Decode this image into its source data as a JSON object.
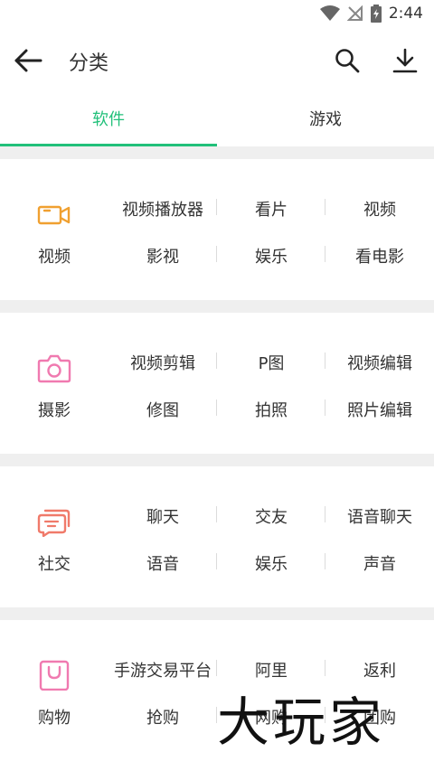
{
  "status": {
    "time": "2:44"
  },
  "appbar": {
    "title": "分类"
  },
  "tabs": [
    {
      "label": "软件"
    },
    {
      "label": "游戏"
    }
  ],
  "accent": "#22c07a",
  "categories": [
    {
      "name": "视频",
      "icon": "video-camera-icon",
      "color": "#f0a030",
      "tags": [
        "视频播放器",
        "看片",
        "视频",
        "影视",
        "娱乐",
        "看电影"
      ]
    },
    {
      "name": "摄影",
      "icon": "camera-icon",
      "color": "#f07ab0",
      "tags": [
        "视频剪辑",
        "P图",
        "视频编辑",
        "修图",
        "拍照",
        "照片编辑"
      ]
    },
    {
      "name": "社交",
      "icon": "chat-bubbles-icon",
      "color": "#f07a6a",
      "tags": [
        "聊天",
        "交友",
        "语音聊天",
        "语音",
        "娱乐",
        "声音"
      ]
    },
    {
      "name": "购物",
      "icon": "shopping-bag-icon",
      "color": "#f07ab0",
      "tags": [
        "手游交易平台",
        "阿里",
        "返利",
        "抢购",
        "网购",
        "团购"
      ]
    }
  ],
  "watermark": "大玩家"
}
